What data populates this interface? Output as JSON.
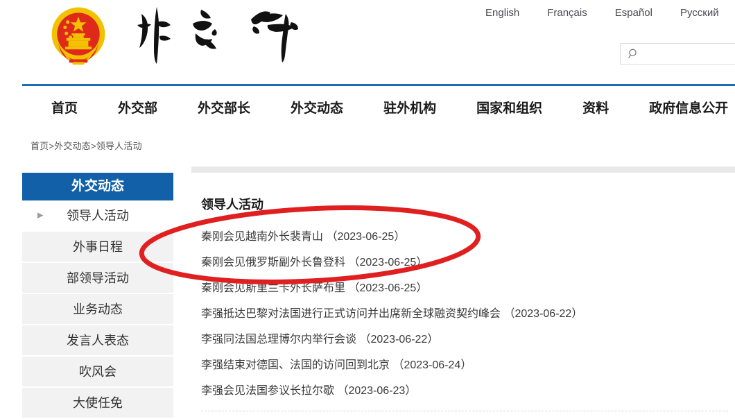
{
  "site": {
    "emblem_alt": "national-emblem",
    "logo_calligraphy": "外交部"
  },
  "languages": [
    {
      "label": "English"
    },
    {
      "label": "Français"
    },
    {
      "label": "Español"
    },
    {
      "label": "Русский"
    }
  ],
  "search": {
    "icon": "search-icon",
    "value": "",
    "placeholder": ""
  },
  "nav": {
    "items": [
      {
        "label": "首页"
      },
      {
        "label": "外交部"
      },
      {
        "label": "外交部长"
      },
      {
        "label": "外交动态"
      },
      {
        "label": "驻外机构"
      },
      {
        "label": "国家和组织"
      },
      {
        "label": "资料"
      },
      {
        "label": "政府信息公开"
      }
    ]
  },
  "breadcrumb": {
    "text": "首页>外交动态>领导人活动"
  },
  "sidebar": {
    "title": "外交动态",
    "items": [
      {
        "label": "领导人活动",
        "active": true,
        "arrow": "▶"
      },
      {
        "label": "外事日程",
        "active": false
      },
      {
        "label": "部领导活动",
        "active": false
      },
      {
        "label": "业务动态",
        "active": false
      },
      {
        "label": "发言人表态",
        "active": false
      },
      {
        "label": "吹风会",
        "active": false
      },
      {
        "label": "大使任免",
        "active": false
      }
    ]
  },
  "main": {
    "title": "领导人活动",
    "news": [
      {
        "title": "秦刚会见越南外长裴青山",
        "date": "（2023-06-25）"
      },
      {
        "title": "秦刚会见俄罗斯副外长鲁登科",
        "date": "（2023-06-25）"
      },
      {
        "title": "秦刚会见斯里兰卡外长萨布里",
        "date": "（2023-06-25）"
      },
      {
        "title": "李强抵达巴黎对法国进行正式访问并出席新全球融资契约峰会",
        "date": "（2023-06-22）"
      },
      {
        "title": "李强同法国总理博尔内举行会谈",
        "date": "（2023-06-22）"
      },
      {
        "title": "李强结束对德国、法国的访问回到北京",
        "date": "（2023-06-24）"
      },
      {
        "title": "李强会见法国参议长拉尔歇",
        "date": "（2023-06-23）"
      }
    ]
  },
  "annotation": {
    "type": "red-ellipse-highlight",
    "color": "#e02020",
    "covers": "first three news items"
  },
  "colors": {
    "brand_blue": "#1160a8",
    "rule_blue": "#1f6cb4",
    "sidebar_gray": "#f2f2f2",
    "annotation_red": "#e02020",
    "emblem_red": "#df2a1b",
    "emblem_gold": "#f2c200"
  }
}
